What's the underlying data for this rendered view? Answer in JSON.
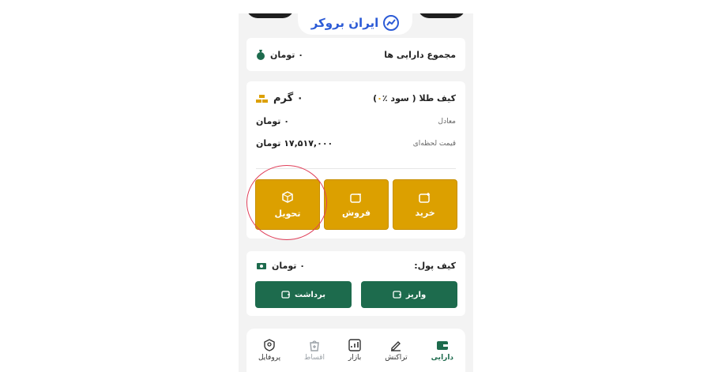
{
  "brand": {
    "name": "ایران بروکر",
    "color": "#2c5bd6"
  },
  "total": {
    "label": "مجموع دارایی ها",
    "value": "۰ تومان"
  },
  "gold_wallet": {
    "title": "کیف طلا ( سود ٪",
    "title_pct": "۰",
    "title_end": ")",
    "amount": "۰ گرم",
    "equivalent_label": "معادل",
    "equivalent_value": "۰ تومان",
    "price_label": "قیمت لحظه‌ای",
    "price_value": "۱۷,۵۱۷,۰۰۰ تومان",
    "buttons": {
      "buy": "خرید",
      "sell": "فروش",
      "deliver": "تحویل"
    }
  },
  "money_wallet": {
    "title": "کیف پول:",
    "value": "۰ تومان",
    "buttons": {
      "deposit": "واریز",
      "withdraw": "برداشت"
    }
  },
  "nav": {
    "assets": "دارایی",
    "transactions": "تراکنش",
    "market": "بازار",
    "installments": "اقساط",
    "profile": "پروفایل"
  },
  "colors": {
    "gold": "#dca000",
    "green": "#1d6b4d",
    "highlight": "#e0405a"
  }
}
